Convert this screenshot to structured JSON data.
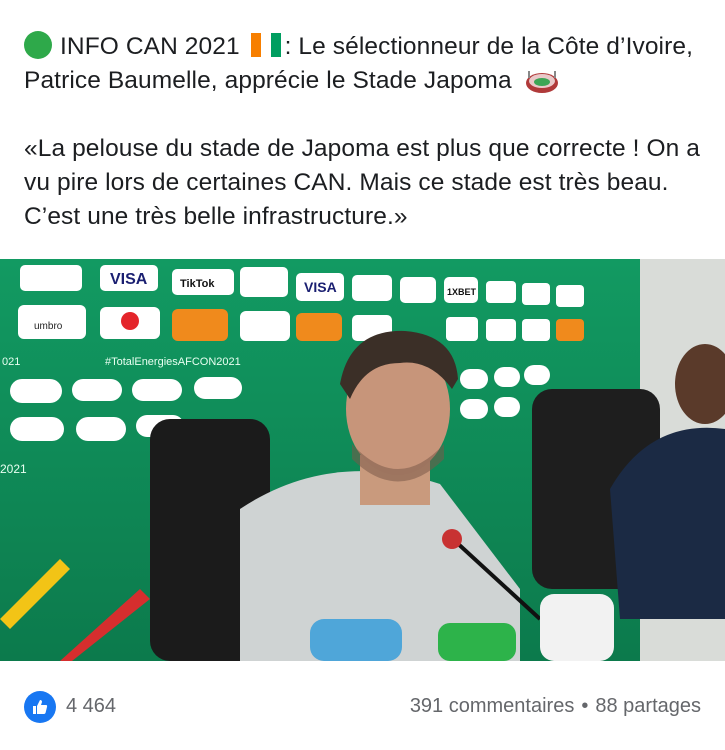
{
  "post": {
    "headline_tag": "INFO CAN 2021",
    "headline_rest": ": Le sélectionneur de la Côte d’Ivoire, Patrice Baumelle, apprécie le Stade Japoma",
    "quote": "«La pelouse du stade de Japoma est plus que correcte ! On a vu pire lors de certaines CAN. Mais ce stade est très beau. C’est une très belle infrastructure.»"
  },
  "photo": {
    "sponsor_visa": "VISA",
    "sponsor_tiktok": "TikTok",
    "sponsor_umbro": "umbro",
    "sponsor_1xbet": "1XBET",
    "hashtag": "#TotalEnergiesAFCON2021",
    "year_fragment_1": "021",
    "year_fragment_2": "2021"
  },
  "reactions": {
    "count": "4 464",
    "comments": "391 commentaires",
    "separator": "•",
    "shares": "88 partages"
  },
  "colors": {
    "facebook_blue": "#1877f2",
    "meta_text": "#65676b",
    "backdrop_green": "#0f8a57",
    "ivory_orange": "#f77f00",
    "ivory_green": "#009e60"
  },
  "icons": {
    "status_dot": "green-circle-icon",
    "flag": "cote-divoire-flag-icon",
    "stadium": "stadium-icon",
    "like": "thumbs-up-icon"
  }
}
